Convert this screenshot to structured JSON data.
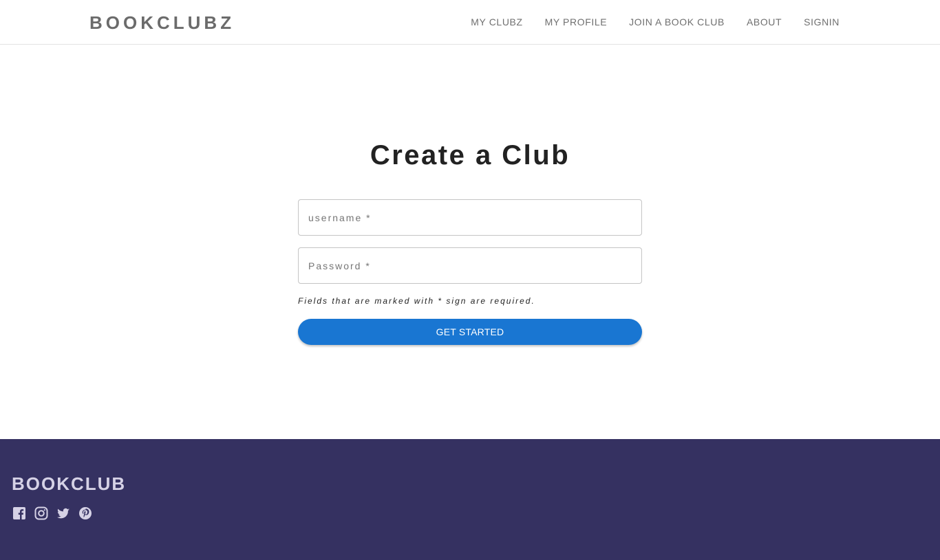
{
  "header": {
    "brand": "BOOKCLUBZ",
    "nav": [
      "MY CLUBZ",
      "MY PROFILE",
      "JOIN A BOOK CLUB",
      "ABOUT",
      "SIGNIN"
    ]
  },
  "form": {
    "title": "Create a Club",
    "username_placeholder": "username *",
    "password_placeholder": "Password *",
    "hint": "Fields that are marked with * sign are required.",
    "submit_label": "GET STARTED"
  },
  "footer": {
    "brand": "BOOKCLUB",
    "socials": [
      "facebook-icon",
      "instagram-icon",
      "twitter-icon",
      "pinterest-icon"
    ]
  },
  "colors": {
    "accent": "#1976d2",
    "footer_bg": "#353161",
    "footer_text": "#d6d2e6",
    "nav_text": "#6f6f6f"
  }
}
